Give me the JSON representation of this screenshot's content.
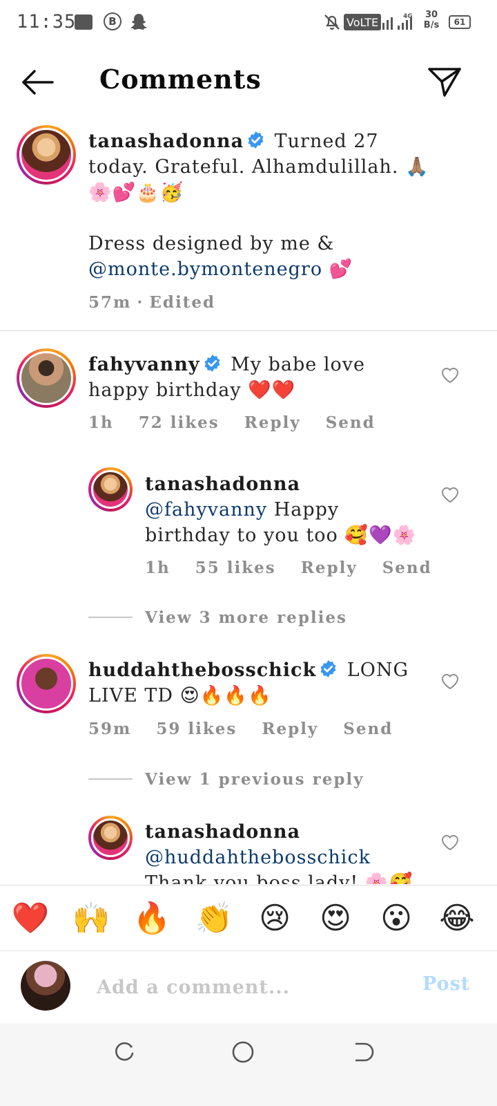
{
  "status_bar": {
    "time": "11:35",
    "network": "VoLTE",
    "network_gen": "4G",
    "speed_value": "30",
    "speed_unit": "B/s",
    "battery": "61"
  },
  "header": {
    "title": "Comments"
  },
  "caption": {
    "username": "tanashadonna",
    "text_1": "Turned 27 today. Grateful. Alhamdulillah.",
    "emoji_1": "🙏🏽",
    "emoji_2": "🌸💕🎂🥳",
    "text_2": "Dress designed by me &",
    "mention": "@monte.bymontenegro",
    "emoji_3": "💕",
    "time": "57m",
    "separator": "·",
    "edited": "Edited"
  },
  "comments": [
    {
      "username": "fahyvanny",
      "text": "My babe love happy birthday",
      "emoji": "❤️❤️",
      "time": "1h",
      "likes": "72 likes",
      "reply_label": "Reply",
      "send_label": "Send"
    },
    {
      "username": "tanashadonna",
      "mention": "@fahyvanny",
      "text": "Happy birthday to you too",
      "emoji": "🥰💜🌸",
      "time": "1h",
      "likes": "55 likes",
      "reply_label": "Reply",
      "send_label": "Send"
    },
    {
      "username": "huddahthebosschick",
      "text": "LONG LIVE TD",
      "emoji": "😍🔥🔥🔥",
      "time": "59m",
      "likes": "59 likes",
      "reply_label": "Reply",
      "send_label": "Send"
    },
    {
      "username": "tanashadonna",
      "mention": "@huddahthebosschick",
      "text": "Thank you boss lady!",
      "emoji": "🌸🥰"
    }
  ],
  "view_more_replies": "View 3 more replies",
  "view_previous_reply": "View 1 previous reply",
  "emoji_bar": [
    "❤️",
    "🙌",
    "🔥",
    "👏",
    "😢",
    "😍",
    "😮",
    "😂"
  ],
  "composer": {
    "placeholder": "Add a comment...",
    "post_label": "Post"
  },
  "colors": {
    "mention": "#0b3a6b",
    "meta_gray": "#8e8e8e",
    "post_disabled": "#b3dbff",
    "verified": "#3897f0"
  }
}
